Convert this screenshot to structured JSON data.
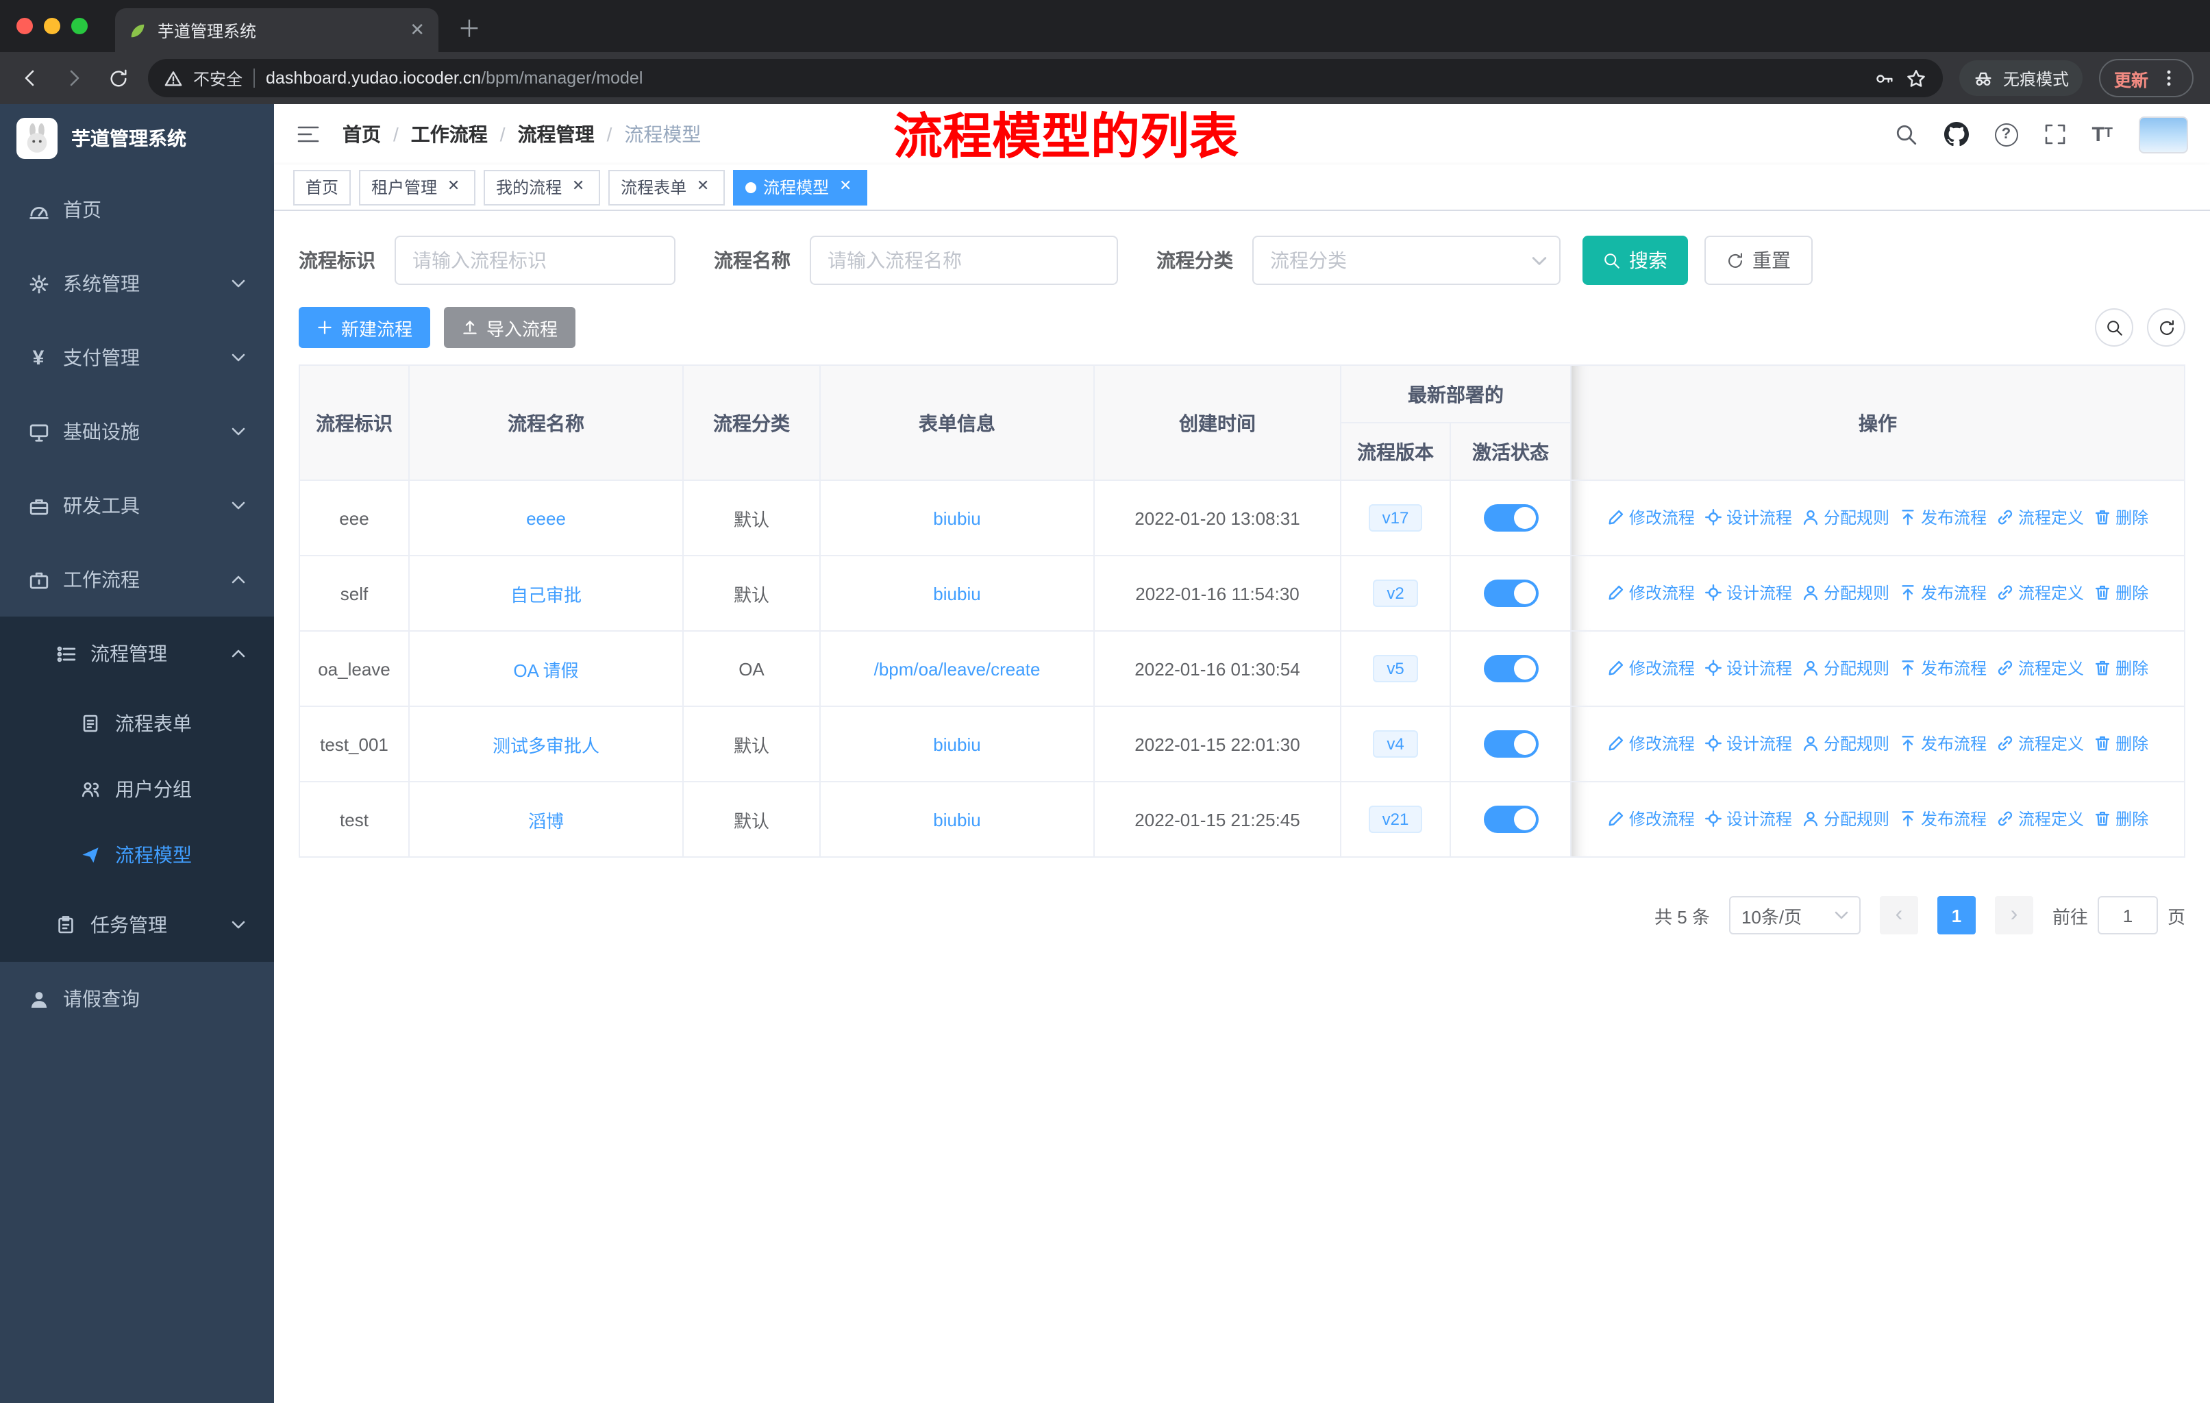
{
  "colors": {
    "accent": "#409eff",
    "search_button": "#14b8a6",
    "sidebar_bg": "#304156",
    "sidebar_submenu_bg": "#1f2d3d",
    "annotation_red": "#ff0000",
    "toggle_on": "#409eff",
    "active_tag_bg": "#409eff"
  },
  "browser": {
    "tab": {
      "title": "芋道管理系统"
    },
    "address": {
      "security_label": "不安全",
      "url_domain": "dashboard.yudao.iocoder.cn",
      "url_path": "/bpm/manager/model"
    },
    "incognito_label": "无痕模式",
    "update_label": "更新"
  },
  "sidebar": {
    "app_title": "芋道管理系统",
    "items": [
      {
        "label": "首页",
        "icon": "dashboard-icon"
      },
      {
        "label": "系统管理",
        "icon": "gear-icon"
      },
      {
        "label": "支付管理",
        "icon": "payment-icon"
      },
      {
        "label": "基础设施",
        "icon": "infrastructure-icon"
      },
      {
        "label": "研发工具",
        "icon": "devtools-icon"
      },
      {
        "label": "工作流程",
        "icon": "workflow-icon",
        "expanded": true
      },
      {
        "label": "流程管理",
        "icon": "process-management-icon",
        "expanded": true
      },
      {
        "label": "流程表单",
        "icon": "form-icon"
      },
      {
        "label": "用户分组",
        "icon": "user-group-icon"
      },
      {
        "label": "流程模型",
        "icon": "paper-plane-icon",
        "active": true
      },
      {
        "label": "任务管理",
        "icon": "task-icon"
      },
      {
        "label": "请假查询",
        "icon": "person-icon"
      }
    ]
  },
  "navbar": {
    "breadcrumb": [
      "首页",
      "工作流程",
      "流程管理",
      "流程模型"
    ],
    "annotation": "流程模型的列表",
    "icons": [
      "search-icon",
      "github-icon",
      "help-icon",
      "fullscreen-icon",
      "font-size-icon",
      "avatar"
    ]
  },
  "tags": [
    {
      "label": "首页",
      "closable": false,
      "active": false
    },
    {
      "label": "租户管理",
      "closable": true,
      "active": false
    },
    {
      "label": "我的流程",
      "closable": true,
      "active": false
    },
    {
      "label": "流程表单",
      "closable": true,
      "active": false
    },
    {
      "label": "流程模型",
      "closable": true,
      "active": true
    }
  ],
  "search": {
    "fields": [
      {
        "label": "流程标识",
        "placeholder": "请输入流程标识",
        "type": "input"
      },
      {
        "label": "流程名称",
        "placeholder": "请输入流程名称",
        "type": "input"
      },
      {
        "label": "流程分类",
        "placeholder": "流程分类",
        "type": "select"
      }
    ],
    "search_label": "搜索",
    "reset_label": "重置"
  },
  "toolbar": {
    "create_label": "新建流程",
    "import_label": "导入流程"
  },
  "table": {
    "headers": {
      "key": "流程标识",
      "name": "流程名称",
      "category": "流程分类",
      "form": "表单信息",
      "created": "创建时间",
      "deploy_group": "最新部署的",
      "version": "流程版本",
      "active": "激活状态",
      "ops": "操作"
    },
    "actions": [
      "修改流程",
      "设计流程",
      "分配规则",
      "发布流程",
      "流程定义",
      "删除"
    ],
    "rows": [
      {
        "key": "eee",
        "name": "eeee",
        "category": "默认",
        "form": "biubiu",
        "created": "2022-01-20 13:08:31",
        "version": "v17",
        "active": true
      },
      {
        "key": "self",
        "name": "自己审批",
        "category": "默认",
        "form": "biubiu",
        "created": "2022-01-16 11:54:30",
        "version": "v2",
        "active": true
      },
      {
        "key": "oa_leave",
        "name": "OA 请假",
        "category": "OA",
        "form": "/bpm/oa/leave/create",
        "created": "2022-01-16 01:30:54",
        "version": "v5",
        "active": true
      },
      {
        "key": "test_001",
        "name": "测试多审批人",
        "category": "默认",
        "form": "biubiu",
        "created": "2022-01-15 22:01:30",
        "version": "v4",
        "active": true
      },
      {
        "key": "test",
        "name": "滔博",
        "category": "默认",
        "form": "biubiu",
        "created": "2022-01-15 21:25:45",
        "version": "v21",
        "active": true
      }
    ]
  },
  "pagination": {
    "total": "共 5 条",
    "page_size": "10条/页",
    "current_page": "1",
    "goto_label": "前往",
    "goto_value": "1",
    "page_unit": "页"
  }
}
